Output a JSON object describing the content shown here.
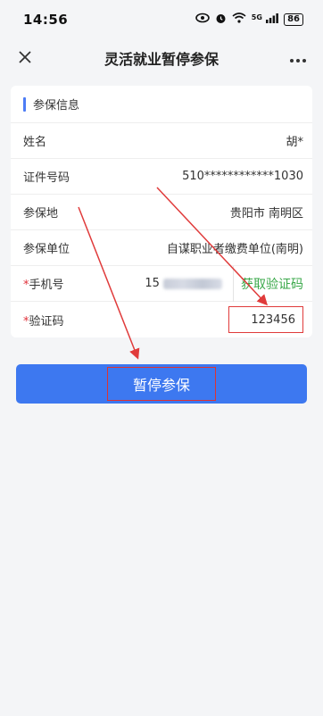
{
  "status_bar": {
    "time": "14:56",
    "icons": [
      "eye-icon",
      "alarm-icon",
      "wifi-icon",
      "signal-icon"
    ],
    "network": "5G",
    "battery": "86"
  },
  "nav": {
    "close_icon": "close-icon",
    "title": "灵活就业暂停参保",
    "more_icon": "more-icon"
  },
  "section": {
    "title": "参保信息"
  },
  "rows": [
    {
      "label": "姓名",
      "value": "胡*"
    },
    {
      "label": "证件号码",
      "value": "510************1030"
    },
    {
      "label": "参保地",
      "value": "贵阳市 南明区"
    },
    {
      "label": "参保单位",
      "value": "自谋职业者缴费单位(南明)"
    }
  ],
  "phone": {
    "required_mark": "*",
    "label": "手机号",
    "value_prefix": "15",
    "get_code_label": "获取验证码"
  },
  "captcha": {
    "required_mark": "*",
    "label": "验证码",
    "value": "123456"
  },
  "submit": {
    "label": "暂停参保"
  },
  "colors": {
    "accent": "#4d7cf5",
    "button": "#3d78f0",
    "get_code": "#3aa84a",
    "required": "#e0313b",
    "annotation": "#e03b3b"
  }
}
